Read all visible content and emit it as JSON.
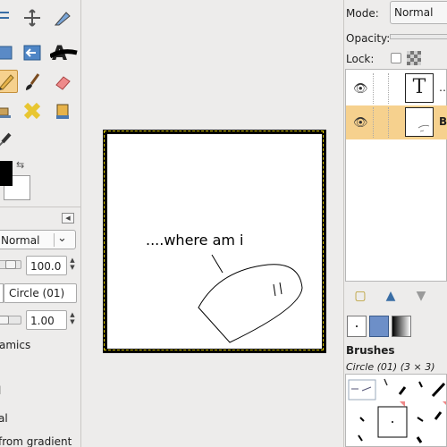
{
  "toolbox": {
    "tools": [
      {
        "name": "align-tool-icon"
      },
      {
        "name": "transform-tool-icon"
      },
      {
        "name": "paths-tool-icon"
      },
      {
        "name": "perspective-tool-icon"
      },
      {
        "name": "flip-tool-icon"
      },
      {
        "name": "text-tool-icon"
      },
      {
        "name": "pencil-tool-icon"
      },
      {
        "name": "paintbrush-tool-icon"
      },
      {
        "name": "eraser-tool-icon"
      },
      {
        "name": "clone-tool-icon"
      },
      {
        "name": "heal-tool-icon"
      },
      {
        "name": "smudge-tool-icon"
      },
      {
        "name": "color-picker-tool-icon"
      }
    ],
    "active_tool": "pencil",
    "fg_color": "#000000",
    "bg_color": "#ffffff",
    "options": {
      "mode_value": "Normal",
      "opacity_value": "100.0",
      "brush_value": "Circle (01)",
      "size_value": "1.00",
      "dynamics_label": "amics",
      "partial_lines": [
        "l",
        "al",
        "from gradient"
      ]
    }
  },
  "canvas": {
    "image_text": "....where am i",
    "selection_color": "#e8d400"
  },
  "layers_dock": {
    "mode_label": "Mode:",
    "mode_value": "Normal",
    "opacity_label": "Opacity:",
    "lock_label": "Lock:",
    "layers": [
      {
        "name": "…",
        "type": "text"
      },
      {
        "name": "Ba",
        "type": "image",
        "selected": true
      }
    ]
  },
  "brushes_dock": {
    "title": "Brushes",
    "current_brush": "Circle (01) (3 × 3)"
  },
  "colors": {
    "accent_selected": "#f6d18e",
    "panel_bg": "#edeceb"
  }
}
